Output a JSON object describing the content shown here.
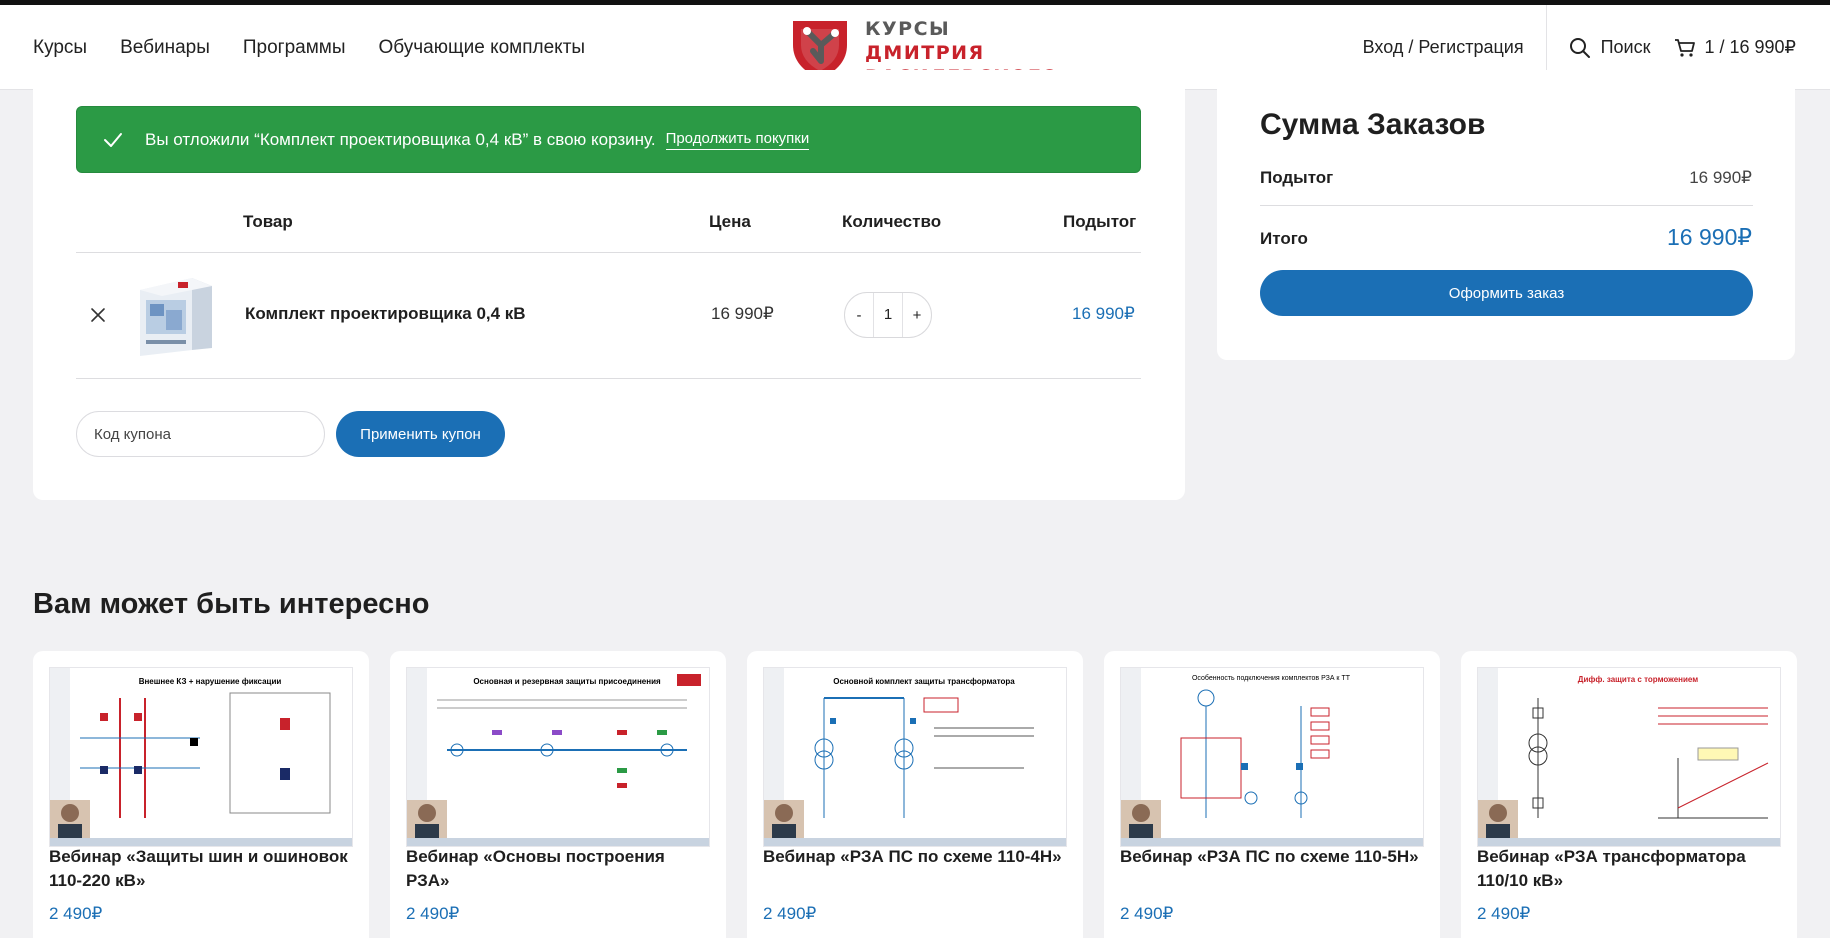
{
  "header": {
    "nav": [
      "Курсы",
      "Вебинары",
      "Программы",
      "Обучающие комплекты"
    ],
    "logo": {
      "line1": "КУРСЫ",
      "line2": "ДМИТРИЯ",
      "line3": "ВАСИЛЕВСКОГО"
    },
    "login": "Вход / Регистрация",
    "search": "Поиск",
    "cart": "1 / 16 990₽"
  },
  "notice": {
    "text": "Вы отложили “Комплект проектировщика 0,4 кВ” в свою корзину.",
    "link": "Продолжить покупки"
  },
  "cart_table": {
    "headers": {
      "product": "Товар",
      "price": "Цена",
      "quantity": "Количество",
      "subtotal": "Подытог"
    },
    "item": {
      "remove_icon": "close-icon",
      "name": "Комплект проектировщика 0,4 кВ",
      "price": "16 990₽",
      "qty_minus": "-",
      "qty": "1",
      "qty_plus": "+",
      "subtotal": "16 990₽"
    }
  },
  "coupon": {
    "placeholder": "Код купона",
    "button": "Применить купон"
  },
  "totals": {
    "title": "Сумма Заказов",
    "subtotal_label": "Подытог",
    "subtotal_value": "16 990₽",
    "total_label": "Итого",
    "total_value": "16 990₽",
    "checkout": "Оформить заказ"
  },
  "recommended": {
    "title": "Вам может быть интересно",
    "items": [
      {
        "name": "Вебинар «Защиты шин и ошиновок 110-220 кВ»",
        "price": "2 490₽",
        "slide_title": "Внешнее КЗ + нарушение фиксации"
      },
      {
        "name": "Вебинар «Основы построения РЗА»",
        "price": "2 490₽",
        "slide_title": "Основная и резервная защиты присоединения"
      },
      {
        "name": "Вебинар «РЗА ПС по схеме 110-4Н»",
        "price": "2 490₽",
        "slide_title": "Основной комплект защиты трансформатора"
      },
      {
        "name": "Вебинар «РЗА ПС по схеме 110-5Н»",
        "price": "2 490₽",
        "slide_title": "Особенность подключения комплектов РЗА к ТТ"
      },
      {
        "name": "Вебинар «РЗА трансформатора 110/10 кВ»",
        "price": "2 490₽",
        "slide_title": "Дифф. защита с торможением"
      }
    ]
  },
  "colors": {
    "accent": "#1b6fb5",
    "success": "#2b9a45",
    "brand_red": "#c8222b"
  }
}
